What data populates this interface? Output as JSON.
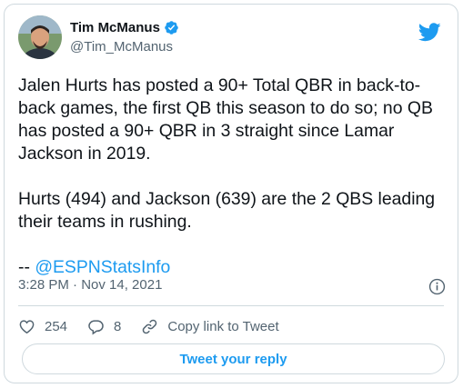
{
  "author": {
    "display_name": "Tim McManus",
    "handle": "@Tim_McManus",
    "verified": true
  },
  "icons": {
    "brand": "twitter-bird-icon",
    "verified": "verified-badge-icon",
    "info": "info-icon",
    "like": "heart-icon",
    "reply": "reply-bubble-icon",
    "link": "link-icon"
  },
  "tweet": {
    "paragraph_1": "Jalen Hurts has posted a 90+ Total QBR in back-to-back games, the first QB this season to do so; no QB has posted a 90+ QBR in 3 straight since Lamar Jackson in 2019.",
    "paragraph_2": "Hurts (494) and Jackson (639) are the 2 QBS leading their teams in rushing.",
    "credit_prefix": "-- ",
    "credit_mention": "@ESPNStatsInfo"
  },
  "meta": {
    "timestamp": "3:28 PM · Nov 14, 2021"
  },
  "actions": {
    "likes": "254",
    "replies": "8",
    "copy_link": "Copy link to Tweet",
    "reply_button": "Tweet your reply"
  },
  "colors": {
    "accent": "#1d9bf0",
    "text": "#0f1419",
    "secondary": "#536471",
    "border": "#cfd9de"
  }
}
